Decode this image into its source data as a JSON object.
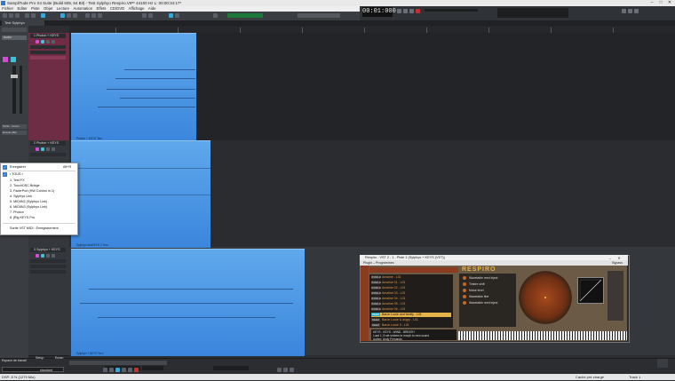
{
  "window": {
    "title": "SampliTude Pro X4 Suite (Build 605, 64 Bit)   -   Test Sylphyo Respiro.VIP*   44100 Hz L: 00:00:34:17*",
    "controls": [
      "–",
      "□",
      "✕"
    ]
  },
  "menu": {
    "items": [
      "Fichier",
      "Editer",
      "Piste",
      "Objet",
      "Lecture",
      "Automation",
      "Effets",
      "CD/DVD",
      "Affichage",
      "Aide"
    ]
  },
  "transport": {
    "timecode": "00:01:000"
  },
  "tab": {
    "label": "Test Sylphyo Respiro.VIP*"
  },
  "inspector": {
    "labels": [
      "Audio",
      "Sortie : Aucun",
      "Envoie effet"
    ]
  },
  "tracks": [
    {
      "index": "1",
      "name": "Photon + KEYS"
    },
    {
      "index": "2",
      "name": "Photon + KEYS"
    },
    {
      "index": "3",
      "name": "Sylphyo + KEYS"
    }
  ],
  "clips": [
    {
      "label": "Photon + KEYS Tern"
    },
    {
      "label": "Sylphyo 6dnKEYS 2 Tern"
    },
    {
      "label": "Sylphyo + KEYS Tern"
    }
  ],
  "context_menu": {
    "items": [
      {
        "label": "Enregistrer",
        "shortcut": "Alt+R"
      },
      {
        "label": "• TOUS •"
      },
      {
        "label": "1. Test FX"
      },
      {
        "label": "2. TouchOSC Bridge"
      },
      {
        "label": "3. FaderPort   (HW Control In 1)"
      },
      {
        "label": "4. Sylphyo Link"
      },
      {
        "label": "5. MIDIIN2 (Sylphyo Link)"
      },
      {
        "label": "6. MIDIIN3 (Sylphyo Link)"
      },
      {
        "label": "7. Photon"
      },
      {
        "label": "8. jRig KEYS Pro"
      },
      {
        "label": "Sortie VST MIDI : Enregistrement"
      }
    ]
  },
  "plugin": {
    "title": "Respiro - VST 2 - 1 - Piste 1 (Sylphyo + KEYS (VST))",
    "subtitle_left": "Plugin  –  Programmes",
    "subtitle_right": "Bypass",
    "brand": "RESPIRO",
    "articulations": [
      {
        "tag": "WORLD",
        "name": "Amaline - L01"
      },
      {
        "tag": "WORLD",
        "name": "Amaline 01 - L01"
      },
      {
        "tag": "WORLD",
        "name": "Amaline 02 - L01"
      },
      {
        "tag": "WORLD",
        "name": "Amaline 03 - L01"
      },
      {
        "tag": "WORLD",
        "name": "Amaline 04 - L01"
      },
      {
        "tag": "WORLD",
        "name": "Amaline 05 - L01"
      },
      {
        "tag": "WORLD",
        "name": "Amaline 06 - L01"
      },
      {
        "tag": "REED",
        "name": "Baron Louie and family - L01",
        "selected": true
      },
      {
        "tag": "REED",
        "name": "Baron Louie & angry - L01"
      },
      {
        "tag": "REED",
        "name": "Baron Louie II - L01"
      }
    ],
    "controls": [
      "Wavetable reed inject",
      "Timbre shift",
      "Noise level",
      "Wavetable fine",
      "Wavetable reed inject"
    ],
    "info_lines": [
      "KEYS - KEYS - WIND - BREATH",
      "Load 1, 5 set smbers to morph to new sound",
      "Author: Andy Fernando"
    ]
  },
  "bottom": {
    "labels": [
      "Espace de travail",
      "Setup",
      "Ecran"
    ],
    "select": "standard"
  },
  "status": {
    "left": "DSP: 8 %   (1279 Mio)",
    "middle": "Cache pré-chargé",
    "right": "Track 1"
  }
}
